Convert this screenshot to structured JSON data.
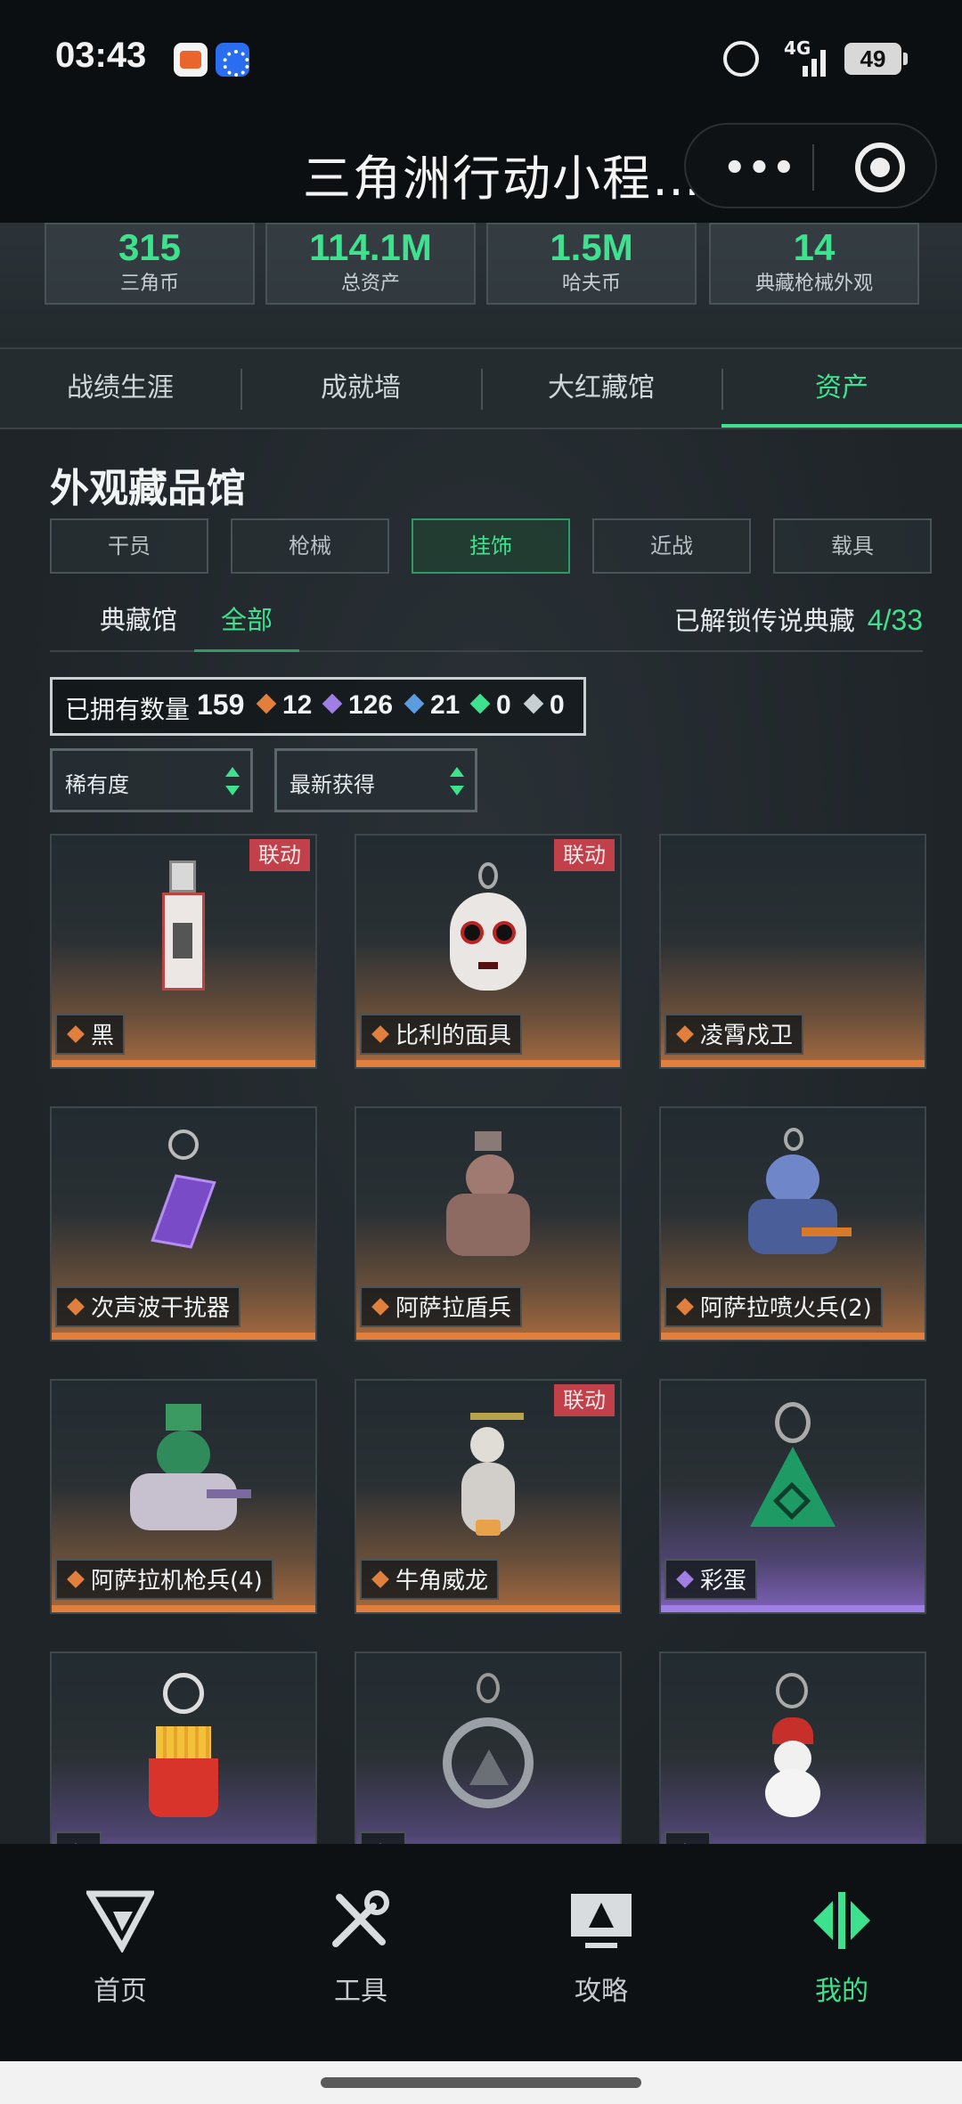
{
  "status_bar": {
    "time": "03:43",
    "network": "4G",
    "battery": "49"
  },
  "title_bar": {
    "title": "三角洲行动小程…",
    "more_icon": "more-dots-icon",
    "close_icon": "target-circle-icon"
  },
  "stats": [
    {
      "value": "315",
      "label": "三角币"
    },
    {
      "value": "114.1M",
      "label": "总资产"
    },
    {
      "value": "1.5M",
      "label": "哈夫币"
    },
    {
      "value": "14",
      "label": "典藏枪械外观"
    }
  ],
  "tabs": [
    {
      "label": "战绩生涯",
      "active": false
    },
    {
      "label": "成就墙",
      "active": false
    },
    {
      "label": "大红藏馆",
      "active": false
    },
    {
      "label": "资产",
      "active": true
    }
  ],
  "gallery": {
    "title": "外观藏品馆",
    "categories": [
      {
        "label": "干员",
        "active": false
      },
      {
        "label": "枪械",
        "active": false
      },
      {
        "label": "挂饰",
        "active": true
      },
      {
        "label": "近战",
        "active": false
      },
      {
        "label": "载具",
        "active": false
      }
    ],
    "subtabs": [
      {
        "label": "典藏馆",
        "active": false
      },
      {
        "label": "全部",
        "active": true
      }
    ],
    "unlock_label": "已解锁传说典藏",
    "unlock_count": "4/33",
    "owned_label": "已拥有数量",
    "owned_total": "159",
    "rarity_counts": [
      {
        "value": "12",
        "color": "#e0803c"
      },
      {
        "value": "126",
        "color": "#9f7ee6"
      },
      {
        "value": "21",
        "color": "#5b9be0"
      },
      {
        "value": "0",
        "color": "#3ee28e"
      },
      {
        "value": "0",
        "color": "#c8cfd3"
      }
    ],
    "filters": {
      "sort_rarity": "稀有度",
      "sort_recent": "最新获得"
    },
    "items": [
      {
        "name": "黑",
        "badge": "联动",
        "rarity": "legend",
        "art": "card-charm-art"
      },
      {
        "name": "比利的面具",
        "badge": "联动",
        "rarity": "legend",
        "art": "mask-charm-art"
      },
      {
        "name": "凌霄戍卫",
        "badge": "",
        "rarity": "legend",
        "art": ""
      },
      {
        "name": "次声波干扰器",
        "badge": "",
        "rarity": "legend",
        "art": "crystal-charm-art"
      },
      {
        "name": "阿萨拉盾兵",
        "badge": "",
        "rarity": "legend",
        "art": "soldier-charm-art"
      },
      {
        "name": "阿萨拉喷火兵(2)",
        "badge": "",
        "rarity": "legend",
        "art": "flamer-charm-art"
      },
      {
        "name": "阿萨拉机枪兵(4)",
        "badge": "",
        "rarity": "legend",
        "art": "gunner-charm-art"
      },
      {
        "name": "牛角威龙",
        "badge": "联动",
        "rarity": "legend",
        "art": "bird-charm-art"
      },
      {
        "name": "彩蛋",
        "badge": "",
        "rarity": "epic",
        "art": "triangle-charm-art"
      },
      {
        "name": "",
        "badge": "",
        "rarity": "epic",
        "art": "fries-charm-art"
      },
      {
        "name": "",
        "badge": "",
        "rarity": "epic",
        "art": "anniversary-charm-art"
      },
      {
        "name": "",
        "badge": "",
        "rarity": "epic",
        "art": "snowman-charm-art"
      }
    ]
  },
  "bottom_nav": [
    {
      "label": "首页",
      "icon": "home-logo-icon",
      "active": false
    },
    {
      "label": "工具",
      "icon": "tools-icon",
      "active": false
    },
    {
      "label": "攻略",
      "icon": "guide-monitor-icon",
      "active": false
    },
    {
      "label": "我的",
      "icon": "profile-logo-icon",
      "active": true
    }
  ]
}
